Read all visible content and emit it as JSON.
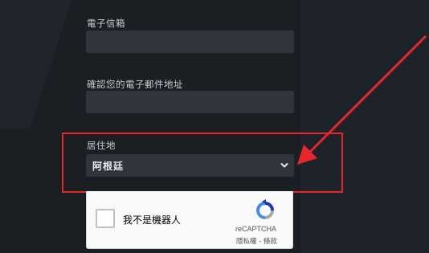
{
  "form": {
    "email_label": "電子信箱",
    "email_value": "",
    "confirm_email_label": "確認您的電子郵件地址",
    "confirm_email_value": "",
    "residence_label": "居住地",
    "residence_value": "阿根廷"
  },
  "recaptcha": {
    "checkbox_label": "我不是機器人",
    "brand": "reCAPTCHA",
    "links": "隱私權 - 條款"
  },
  "colors": {
    "highlight": "#e5262b",
    "background": "#1b1f23",
    "field": "#30353c"
  }
}
